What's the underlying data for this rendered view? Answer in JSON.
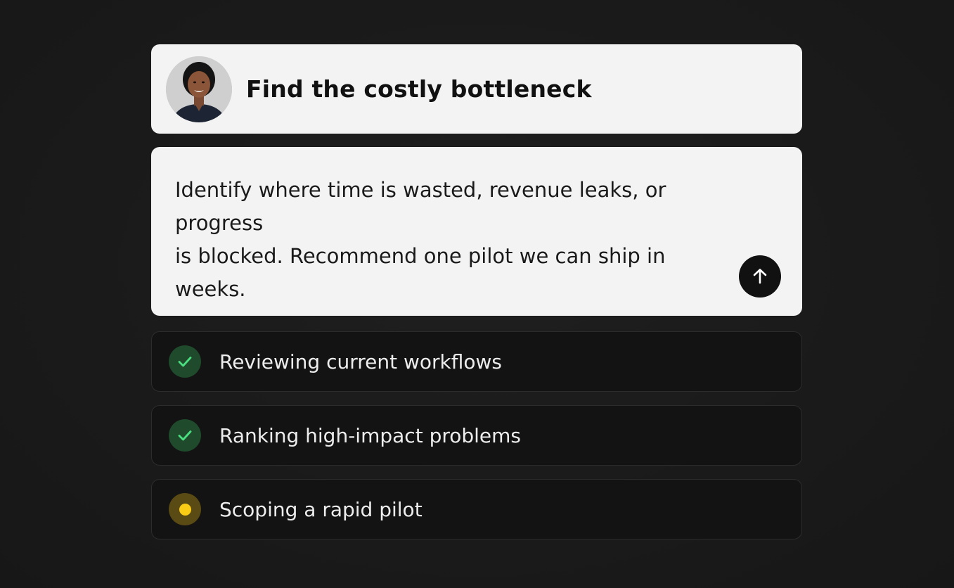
{
  "card": {
    "title": "Find the costly bottleneck",
    "avatar_icon": "person-avatar"
  },
  "prompt": {
    "line1": "Identify where time is wasted, revenue leaks, or progress",
    "line2": "is blocked. Recommend one pilot we can ship in weeks.",
    "send_icon": "arrow-up-icon"
  },
  "steps": [
    {
      "label": "Reviewing current workflows",
      "status": "done",
      "icon": "check-icon"
    },
    {
      "label": "Ranking high-impact problems",
      "status": "done",
      "icon": "check-icon"
    },
    {
      "label": "Scoping a rapid pilot",
      "status": "in-progress",
      "icon": "dot-icon"
    }
  ],
  "colors": {
    "background": "#1b1b1b",
    "card": "#f3f3f3",
    "done_check": "#4ade80",
    "in_progress_dot": "#facc15"
  }
}
